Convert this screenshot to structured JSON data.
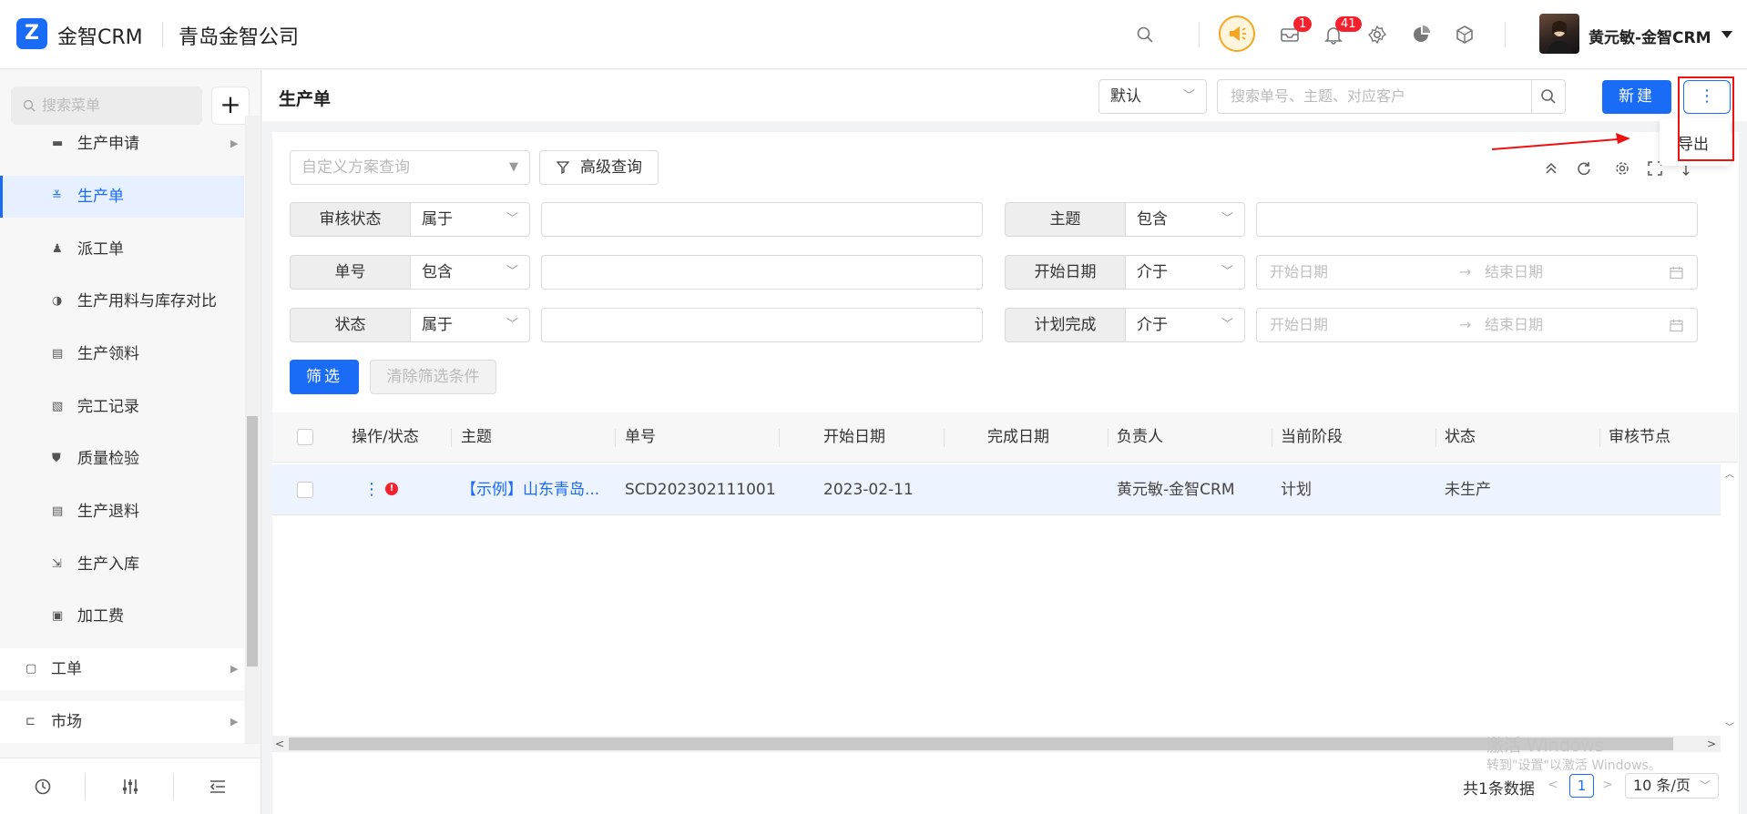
{
  "header": {
    "logo_glyph": "Z",
    "app_name": "金智CRM",
    "company": "青岛金智公司",
    "notification_badge": "1",
    "bell_badge": "41",
    "user_name": "黄元敏-金智CRM"
  },
  "sidebar": {
    "search_placeholder": "搜索菜单",
    "add_label": "+",
    "items": [
      {
        "label": "生产申请",
        "icon": "folder-icon",
        "glyph": "▬"
      },
      {
        "label": "生产单",
        "icon": "list-icon",
        "glyph": "≚"
      },
      {
        "label": "派工单",
        "icon": "worker-icon",
        "glyph": "♟"
      },
      {
        "label": "生产用料与库存对比",
        "icon": "contrast-icon",
        "glyph": "◑"
      },
      {
        "label": "生产领料",
        "icon": "document-icon",
        "glyph": "▤"
      },
      {
        "label": "完工记录",
        "icon": "edit-icon",
        "glyph": "▧"
      },
      {
        "label": "质量检验",
        "icon": "shield-icon",
        "glyph": "⛊"
      },
      {
        "label": "生产退料",
        "icon": "document-icon",
        "glyph": "▤"
      },
      {
        "label": "生产入库",
        "icon": "import-icon",
        "glyph": "⇲"
      },
      {
        "label": "加工费",
        "icon": "money-icon",
        "glyph": "▣"
      },
      {
        "label": "工单",
        "icon": "ticket-icon",
        "glyph": "▢"
      },
      {
        "label": "市场",
        "icon": "flag-icon",
        "glyph": "⊏"
      }
    ]
  },
  "page": {
    "title": "生产单",
    "view_select": "默认",
    "search_placeholder": "搜索单号、主题、对应客户",
    "new_button": "新建",
    "more_button": "⋮",
    "dropdown_export": "导出"
  },
  "filters": {
    "scheme_placeholder": "自定义方案查询",
    "advanced": "高级查询",
    "rows": [
      {
        "label": "审核状态",
        "op": "属于"
      },
      {
        "label": "主题",
        "op": "包含"
      },
      {
        "label": "单号",
        "op": "包含"
      },
      {
        "label": "开始日期",
        "op": "介于",
        "start": "开始日期",
        "end": "结束日期"
      },
      {
        "label": "状态",
        "op": "属于"
      },
      {
        "label": "计划完成",
        "op": "介于",
        "start": "开始日期",
        "end": "结束日期"
      }
    ],
    "filter_button": "筛选",
    "clear_button": "清除筛选条件"
  },
  "table": {
    "columns": [
      "操作/状态",
      "主题",
      "单号",
      "开始日期",
      "完成日期",
      "负责人",
      "当前阶段",
      "状态",
      "审核节点"
    ],
    "rows": [
      {
        "topic": "【示例】山东青岛...",
        "number": "SCD202302111001",
        "start_date": "2023-02-11",
        "finish_date": "",
        "owner": "黄元敏-金智CRM",
        "stage": "计划",
        "status": "未生产",
        "audit_node": ""
      }
    ]
  },
  "pager": {
    "total": "共1条数据",
    "current": "1",
    "page_size": "10 条/页"
  },
  "watermark": {
    "line1": "激活 Windows",
    "line2": "转到\"设置\"以激活 Windows。"
  },
  "colors": {
    "accent": "#1a6cf6",
    "highlight": "#e11111",
    "badge": "#f5222d"
  }
}
